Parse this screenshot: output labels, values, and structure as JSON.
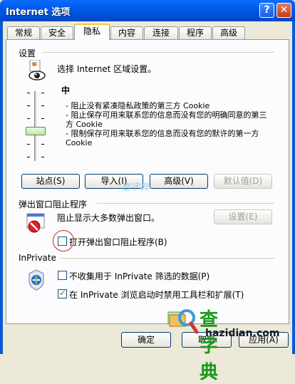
{
  "window": {
    "title": "Internet 选项",
    "help_glyph": "?",
    "close_glyph": "✕"
  },
  "tabs": [
    {
      "label": "常规"
    },
    {
      "label": "安全"
    },
    {
      "label": "隐私"
    },
    {
      "label": "内容"
    },
    {
      "label": "连接"
    },
    {
      "label": "程序"
    },
    {
      "label": "高级"
    }
  ],
  "settings": {
    "header": "设置",
    "prompt": "选择 Internet 区域设置。",
    "level": "中",
    "description": "- 阻止没有紧凑隐私政策的第三方 Cookie\n- 阻止保存可用来联系您的信息而没有您的明确同意的第三方 Cookie\n- 限制保存可用来联系您的信息而没有您的默许的第一方 Cookie",
    "buttons": {
      "sites": "站点(S)",
      "import": "导入(I)",
      "advanced": "高级(V)",
      "default": "默认值(D)"
    }
  },
  "popup": {
    "header": "弹出窗口阻止程序",
    "text": "阻止显示大多数弹出窗口。",
    "settings_button": "设置(E)",
    "turn_on_label": "打开弹出窗口阻止程序(B)",
    "turn_on_checked": false
  },
  "inprivate": {
    "header": "InPrivate",
    "no_collect_label": "不收集用于 InPrivate 筛选的数据(P)",
    "no_collect_checked": false,
    "disable_toolbars_label": "在 InPrivate 浏览启动时禁用工具栏和扩展(T)",
    "disable_toolbars_checked": true
  },
  "footer": {
    "ok": "确定",
    "cancel": "取消",
    "apply": "应用(A)"
  },
  "watermarks": {
    "logo1": "查字典",
    "logo2": "查字典",
    "url": "hazidian.com"
  },
  "colors": {
    "title_blue": "#0058e6",
    "panel_bg": "#fcfcfe",
    "dialog_bg": "#ece9d8",
    "tab_highlight": "#ffc83c"
  }
}
